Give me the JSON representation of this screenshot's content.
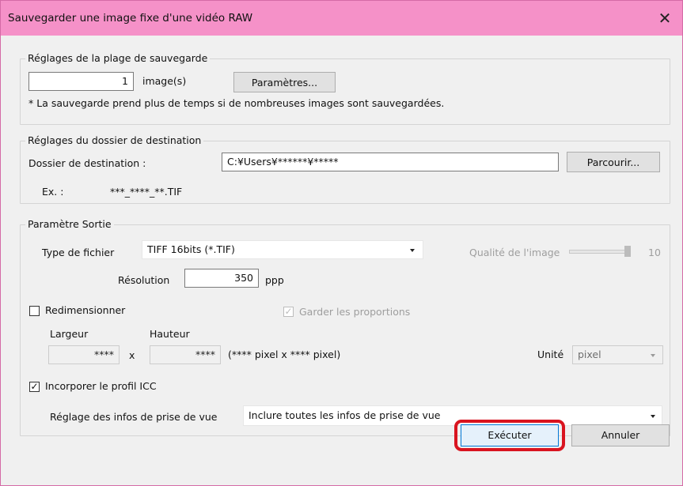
{
  "window": {
    "title": "Sauvegarder une image fixe d'une vidéo RAW",
    "close_glyph": "✕"
  },
  "range": {
    "legend": "Réglages de la plage de sauvegarde",
    "count": "1",
    "unit": "image(s)",
    "params_button": "Paramètres...",
    "note": "* La sauvegarde prend plus de temps si de nombreuses images sont sauvegardées."
  },
  "destination": {
    "legend": "Réglages du dossier de destination",
    "folder_label": "Dossier de destination :",
    "folder_value": "C:¥Users¥******¥*****",
    "browse_button": "Parcourir...",
    "example_label": "Ex. :",
    "example_value": "***_****_**.TIF"
  },
  "output": {
    "legend": "Paramètre Sortie",
    "filetype_label": "Type de fichier",
    "filetype_value": "TIFF 16bits (*.TIF)",
    "quality_label": "Qualité de l'image",
    "quality_value": "10",
    "resolution_label": "Résolution",
    "resolution_value": "350",
    "resolution_unit": "ppp",
    "resize_label": "Redimensionner",
    "resize_checked": false,
    "keep_ratio_label": "Garder les proportions",
    "keep_ratio_checked": true,
    "width_label": "Largeur",
    "height_label": "Hauteur",
    "width_value": "****",
    "height_value": "****",
    "times": "x",
    "pixel_info": "(**** pixel x **** pixel)",
    "unit_label": "Unité",
    "unit_value": "pixel",
    "icc_label": "Incorporer le profil ICC",
    "icc_checked": true,
    "shooting_info_label": "Réglage des infos de prise de vue",
    "shooting_info_value": "Inclure toutes les infos de prise de vue"
  },
  "actions": {
    "execute": "Exécuter",
    "cancel": "Annuler"
  },
  "colors": {
    "titlebar": "#f591c8",
    "highlight": "#d9141f"
  }
}
